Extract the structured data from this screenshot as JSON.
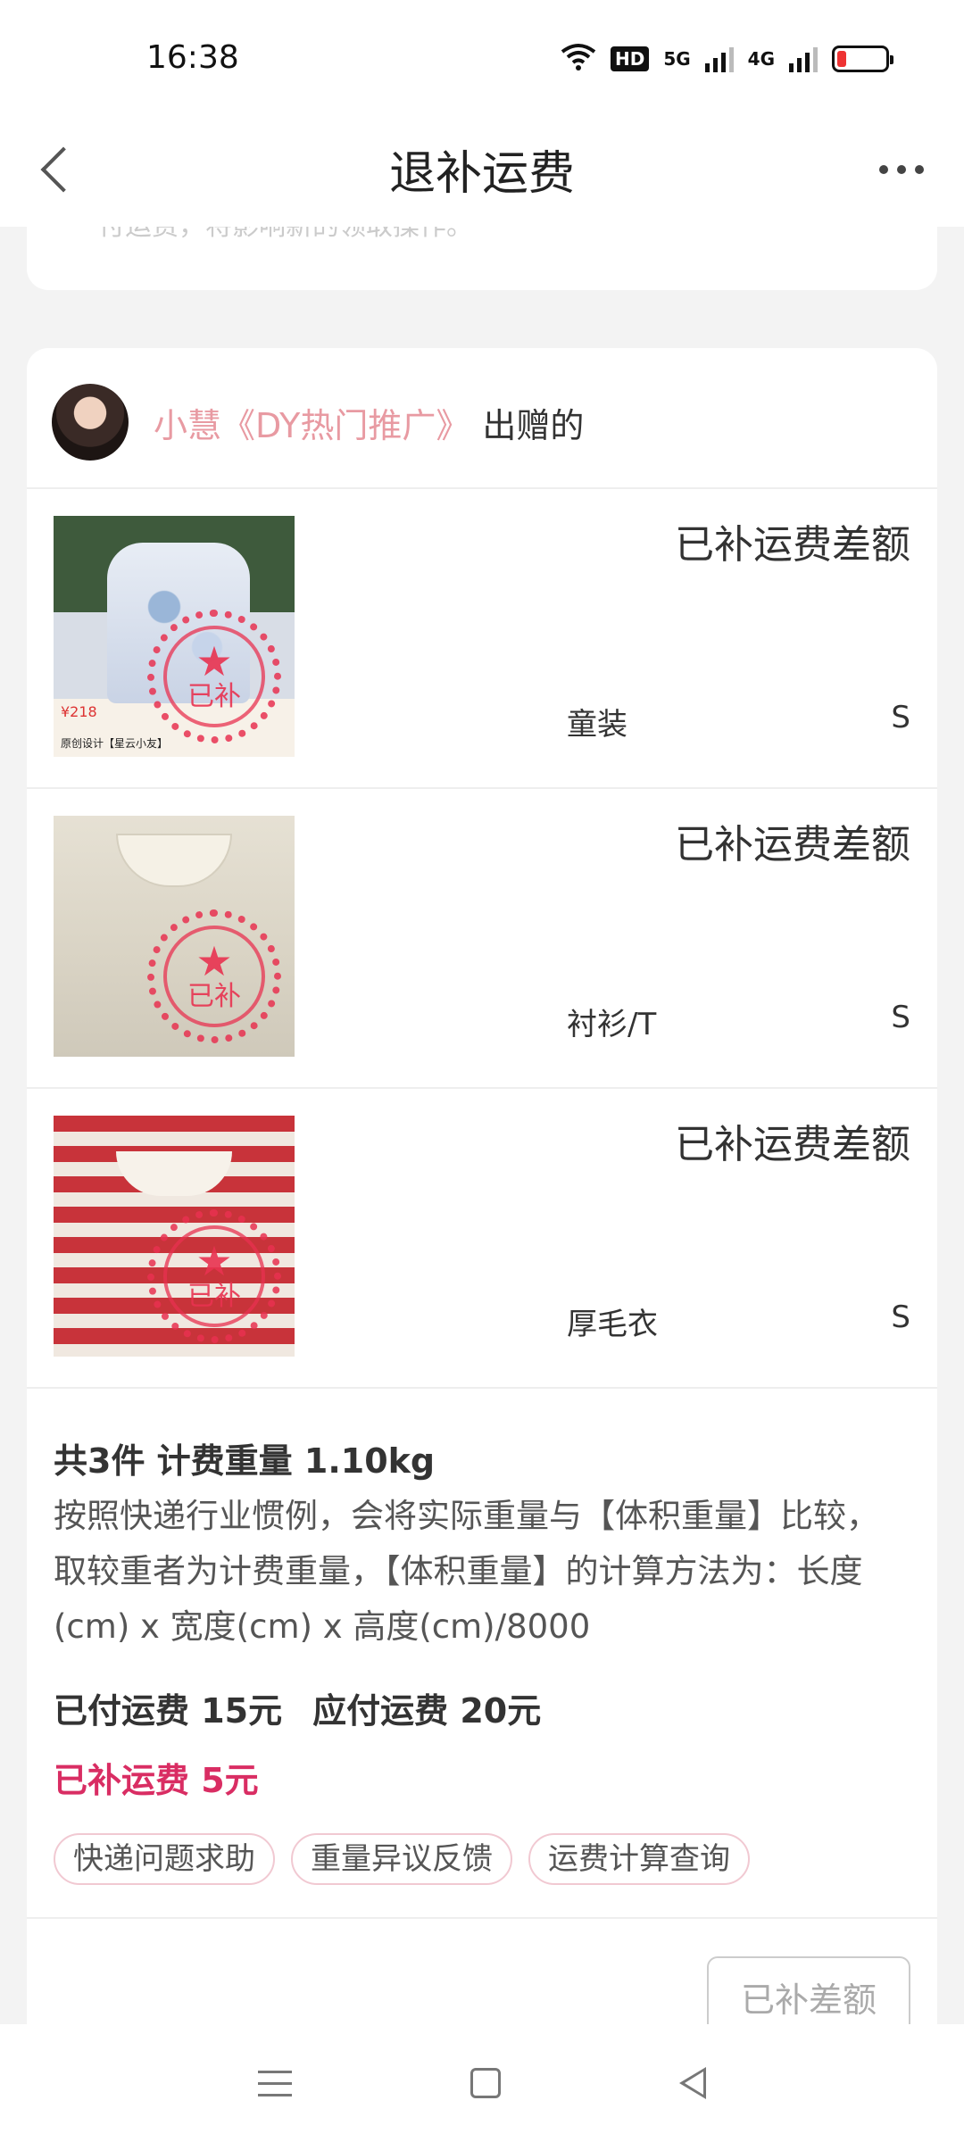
{
  "status_bar": {
    "time": "16:38",
    "hd_label": "HD",
    "net1": "5G",
    "net2": "4G"
  },
  "header": {
    "title": "退补运费"
  },
  "top_card": {
    "text": "付运费，将影响新的领取操作。"
  },
  "giver": {
    "name": "小慧《DY热门推广》",
    "suffix": "出赠的"
  },
  "items": [
    {
      "status": "已补运费差额",
      "category": "童装",
      "size": "S",
      "stamp_star": "★",
      "stamp_text": "已补",
      "thumb_price": "¥218",
      "thumb_caption": "原创设计【星云小友】"
    },
    {
      "status": "已补运费差额",
      "category": "衬衫/T",
      "size": "S",
      "stamp_star": "★",
      "stamp_text": "已补"
    },
    {
      "status": "已补运费差额",
      "category": "厚毛衣",
      "size": "S",
      "stamp_star": "★",
      "stamp_text": "已补"
    }
  ],
  "summary": {
    "title": "共3件 计费重量 1.10kg",
    "description": "按照快递行业惯例，会将实际重量与【体积重量】比较，取较重者为计费重量，【体积重量】的计算方法为：长度(cm) x 宽度(cm) x 高度(cm)/8000",
    "paid": "已付运费 15元",
    "due": "应付运费 20元",
    "refund": "已补运费 5元",
    "refund_color": "#d92d63"
  },
  "chips": [
    "快递问题求助",
    "重量异议反馈",
    "运费计算查询"
  ],
  "action_button": "已补差额"
}
